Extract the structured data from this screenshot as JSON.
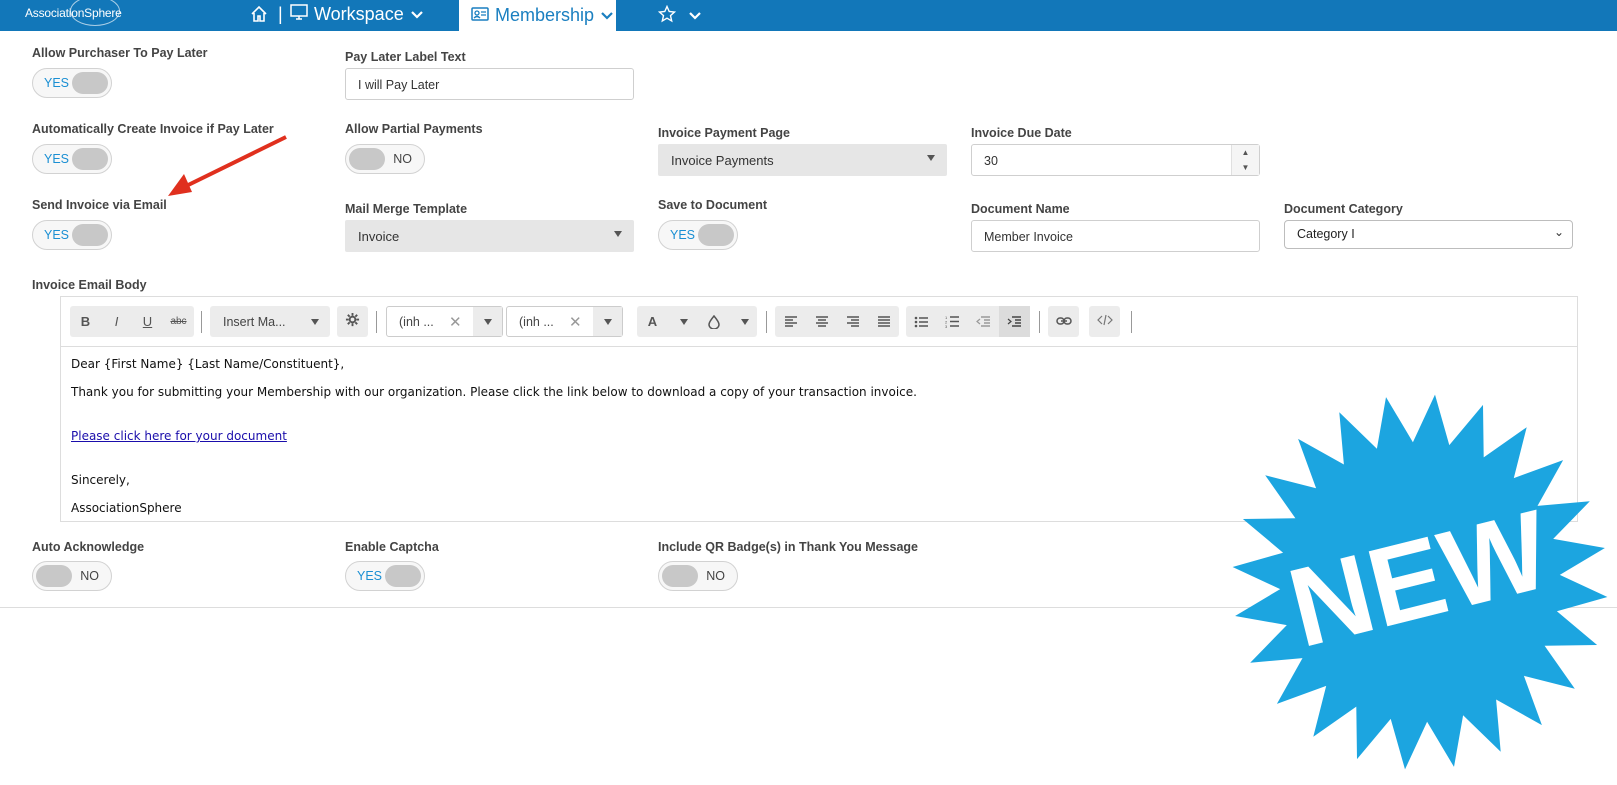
{
  "nav": {
    "logo": "AssociationSphere",
    "sep": "|",
    "workspace": "Workspace",
    "membership": "Membership"
  },
  "fields": {
    "allow_pay_later": {
      "label": "Allow Purchaser To Pay Later",
      "state": "YES"
    },
    "pay_later_label": {
      "label": "Pay Later Label Text",
      "value": "I will Pay Later"
    },
    "auto_create_invoice": {
      "label": "Automatically Create Invoice if Pay Later",
      "state": "YES"
    },
    "partial_payments": {
      "label": "Allow Partial Payments",
      "state": "NO"
    },
    "invoice_payment_page": {
      "label": "Invoice Payment Page",
      "value": "Invoice Payments"
    },
    "invoice_due_date": {
      "label": "Invoice Due Date",
      "value": "30"
    },
    "send_invoice_email": {
      "label": "Send Invoice via Email",
      "state": "YES"
    },
    "mail_merge_template": {
      "label": "Mail Merge Template",
      "value": "Invoice"
    },
    "save_to_document": {
      "label": "Save to Document",
      "state": "YES"
    },
    "document_name": {
      "label": "Document Name",
      "value": "Member Invoice"
    },
    "document_category": {
      "label": "Document Category",
      "value": "Category I"
    },
    "invoice_email_body": {
      "label": "Invoice Email Body"
    },
    "auto_acknowledge": {
      "label": "Auto Acknowledge",
      "state": "NO"
    },
    "enable_captcha": {
      "label": "Enable Captcha",
      "state": "YES"
    },
    "include_qr": {
      "label": "Include QR Badge(s) in Thank You Message",
      "state": "NO"
    }
  },
  "toolbar": {
    "bold": "B",
    "italic": "I",
    "underline": "U",
    "strike": "abc",
    "insert_merge": "Insert Ma...",
    "font_family": "(inh ...",
    "font_size": "(inh ...",
    "font_color": "A"
  },
  "email_body": {
    "greeting": "Dear {First Name} {Last Name/Constituent},",
    "line1": "Thank you for submitting your Membership with our organization. Please click the link below to download a copy of your transaction invoice.",
    "link": "Please click here for your document",
    "closing": "Sincerely,",
    "signature": "AssociationSphere"
  },
  "badge": {
    "text": "NEW",
    "color": "#1ca5e0"
  },
  "colors": {
    "topbar": "#1277b9",
    "accent": "#1a8fd3",
    "arrow": "#e0301e"
  }
}
